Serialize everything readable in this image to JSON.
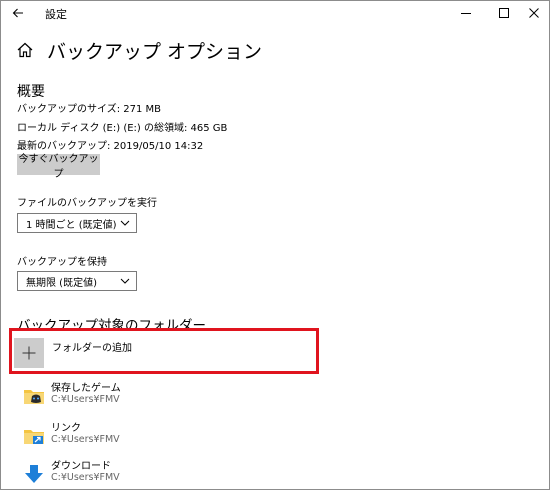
{
  "window": {
    "title": "設定"
  },
  "page": {
    "title": "バックアップ オプション"
  },
  "overview": {
    "heading": "概要",
    "size_line": "バックアップのサイズ: 271 MB",
    "disk_line": "ローカル ディスク (E:) (E:) の総領域: 465 GB",
    "last_line": "最新のバックアップ: 2019/05/10 14:32",
    "backup_now_label": "今すぐバックアップ"
  },
  "run_backup": {
    "label": "ファイルのバックアップを実行",
    "selected": "1 時間ごと (既定値)"
  },
  "keep_backup": {
    "label": "バックアップを保持",
    "selected": "無期限 (既定値)"
  },
  "folders": {
    "heading": "バックアップ対象のフォルダー",
    "add_label": "フォルダーの追加",
    "items": [
      {
        "name": "保存したゲーム",
        "path": "C:¥Users¥FMV",
        "icon": "saved-games-folder-icon"
      },
      {
        "name": "リンク",
        "path": "C:¥Users¥FMV",
        "icon": "links-folder-icon"
      },
      {
        "name": "ダウンロード",
        "path": "C:¥Users¥FMV",
        "icon": "downloads-folder-icon"
      }
    ]
  },
  "colors": {
    "highlight_border": "#e0141e",
    "button_gray": "#cccccc",
    "folder_yellow": "#f4c542",
    "download_blue": "#1e7fd8"
  }
}
